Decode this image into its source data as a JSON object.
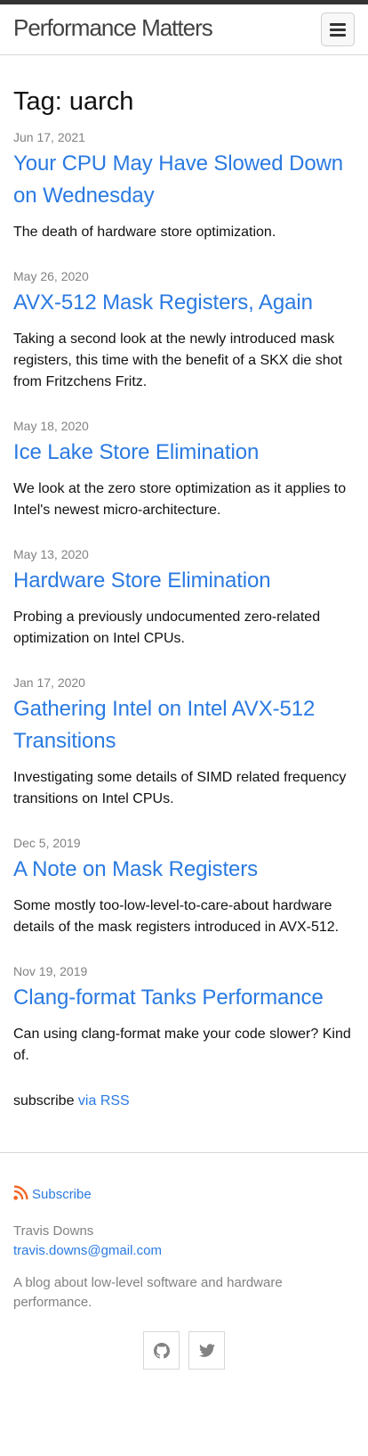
{
  "header": {
    "site_title": "Performance Matters",
    "menu_icon": "hamburger-menu-icon"
  },
  "page": {
    "heading": "Tag: uarch"
  },
  "posts": [
    {
      "date": "Jun 17, 2021",
      "title": "Your CPU May Have Slowed Down on Wednesday",
      "excerpt": "The death of hardware store optimization."
    },
    {
      "date": "May 26, 2020",
      "title": "AVX-512 Mask Registers, Again",
      "excerpt": "Taking a second look at the newly introduced mask registers, this time with the benefit of a SKX die shot from Fritzchens Fritz."
    },
    {
      "date": "May 18, 2020",
      "title": "Ice Lake Store Elimination",
      "excerpt": "We look at the zero store optimization as it applies to Intel's newest micro-architecture."
    },
    {
      "date": "May 13, 2020",
      "title": "Hardware Store Elimination",
      "excerpt": "Probing a previously undocumented zero-related optimization on Intel CPUs."
    },
    {
      "date": "Jan 17, 2020",
      "title": "Gathering Intel on Intel AVX-512 Transitions",
      "excerpt": "Investigating some details of SIMD related frequency transitions on Intel CPUs."
    },
    {
      "date": "Dec 5, 2019",
      "title": "A Note on Mask Registers",
      "excerpt": "Some mostly too-low-level-to-care-about hardware details of the mask registers introduced in AVX-512."
    },
    {
      "date": "Nov 19, 2019",
      "title": "Clang-format Tanks Performance",
      "excerpt": "Can using clang-format make your code slower? Kind of."
    }
  ],
  "rss": {
    "prefix": "subscribe ",
    "link_label": "via RSS"
  },
  "footer": {
    "subscribe_label": "Subscribe",
    "author": "Travis Downs",
    "email": "travis.downs@gmail.com",
    "description": "A blog about low-level software and hardware performance.",
    "social": [
      "github-icon",
      "twitter-icon"
    ]
  },
  "colors": {
    "link": "#2a7ae2",
    "meta": "#828282",
    "rss_orange": "#f26522"
  }
}
